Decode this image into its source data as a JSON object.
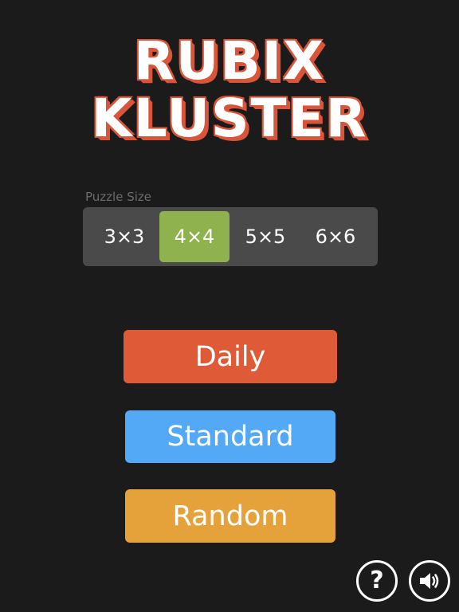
{
  "logo": {
    "line1": "RUBIX",
    "line2": "KLUSTER"
  },
  "puzzle_size": {
    "label": "Puzzle Size",
    "options": [
      "3×3",
      "4×4",
      "5×5",
      "6×6"
    ],
    "selected": "4×4"
  },
  "modes": {
    "daily": "Daily",
    "standard": "Standard",
    "random": "Random"
  },
  "controls": {
    "help_icon": "question-mark-icon",
    "help_glyph": "?",
    "sound_icon": "speaker-icon"
  },
  "colors": {
    "background": "#1b1b1b",
    "logo_outline": "#d9553a",
    "selector_bg": "#4a4a4a",
    "selected_option": "#8fb24f",
    "daily": "#df5a36",
    "standard": "#54a9f6",
    "random": "#e6a23a"
  }
}
